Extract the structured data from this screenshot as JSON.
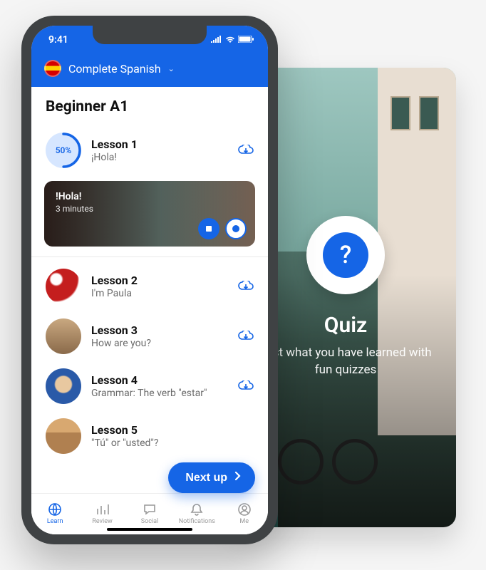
{
  "status": {
    "time": "9:41"
  },
  "header": {
    "course": "Complete Spanish"
  },
  "section": {
    "title": "Beginner A1"
  },
  "lessons": [
    {
      "title": "Lesson 1",
      "sub": "¡Hola!",
      "progress": "50%"
    },
    {
      "title": "Lesson 2",
      "sub": "I'm Paula"
    },
    {
      "title": "Lesson 3",
      "sub": "How are you?"
    },
    {
      "title": "Lesson 4",
      "sub": "Grammar: The verb \"estar\""
    },
    {
      "title": "Lesson 5",
      "sub": "\"Tú\" or \"usted\"?"
    }
  ],
  "featured": {
    "title": "!Hola!",
    "duration": "3 minutes"
  },
  "nextUp": {
    "label": "Next up"
  },
  "tabs": {
    "learn": "Learn",
    "review": "Review",
    "social": "Social",
    "notifications": "Notifications",
    "me": "Me"
  },
  "quiz": {
    "title": "Quiz",
    "subtitle": "Test what you have learned with fun quizzes",
    "symbol": "?"
  }
}
